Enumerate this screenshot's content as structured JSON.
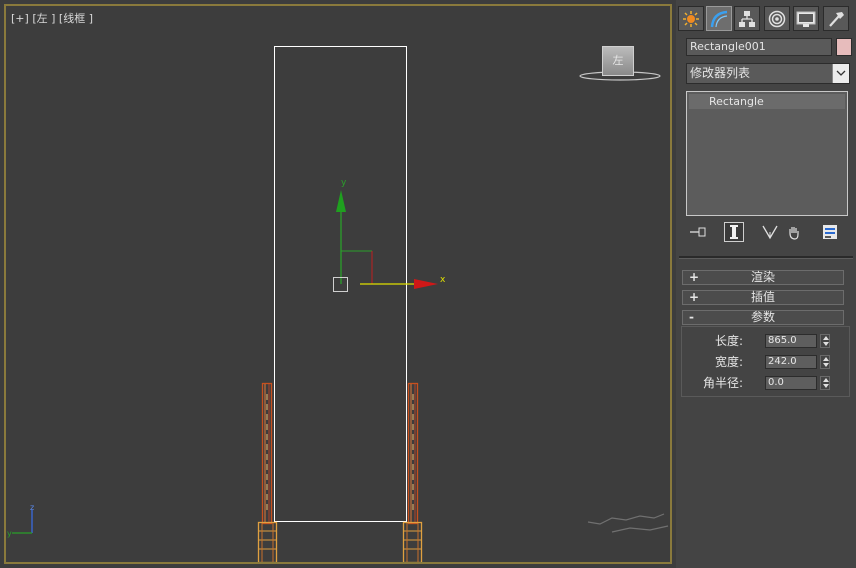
{
  "viewport": {
    "label_plus": "[+]",
    "label_view": "[左 ]",
    "label_shading": "[线框 ]",
    "viewcube_face": "左",
    "gizmo_x": "x",
    "gizmo_y": "y",
    "axis_z": "z",
    "axis_y": "y"
  },
  "command_panel": {
    "tabs": [
      {
        "name": "create-tab",
        "icon": "sun-icon"
      },
      {
        "name": "modify-tab",
        "icon": "modify-arc-icon",
        "active": true
      },
      {
        "name": "hierarchy-tab",
        "icon": "hierarchy-icon"
      },
      {
        "name": "motion-tab",
        "icon": "motion-icon"
      },
      {
        "name": "display-tab",
        "icon": "monitor-icon"
      },
      {
        "name": "utilities-tab",
        "icon": "hammer-icon"
      }
    ],
    "object_name": "Rectangle001",
    "object_color": "#e7bcbc",
    "modifier_list": "修改器列表",
    "stack_items": [
      "Rectangle"
    ],
    "rollouts": {
      "rendering": {
        "sign": "+",
        "label": "渲染"
      },
      "interpolation": {
        "sign": "+",
        "label": "插值"
      },
      "parameters": {
        "sign": "-",
        "label": "参数"
      }
    },
    "params": {
      "length_label": "长度:",
      "length_value": "865.0",
      "width_label": "宽度:",
      "width_value": "242.0",
      "corner_label": "角半径:",
      "corner_value": "0.0"
    }
  }
}
